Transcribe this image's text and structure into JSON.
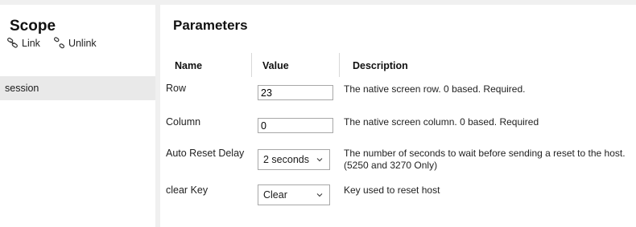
{
  "scope": {
    "title": "Scope",
    "link_label": "Link",
    "unlink_label": "Unlink",
    "items": [
      {
        "label": "session"
      }
    ]
  },
  "parameters": {
    "title": "Parameters",
    "columns": {
      "name": "Name",
      "value": "Value",
      "description": "Description"
    },
    "rows": [
      {
        "name": "Row",
        "value": "23",
        "description": "The native screen row. 0 based. Required."
      },
      {
        "name": "Column",
        "value": "0",
        "description": "The native screen column. 0 based. Required"
      },
      {
        "name": "Auto Reset Delay",
        "value": "2 seconds",
        "description": "The number of seconds to wait before sending a reset to the host.",
        "description_2": "(5250 and 3270 Only)"
      },
      {
        "name": "clear Key",
        "value": "Clear",
        "description": "Key used to reset host"
      }
    ]
  }
}
